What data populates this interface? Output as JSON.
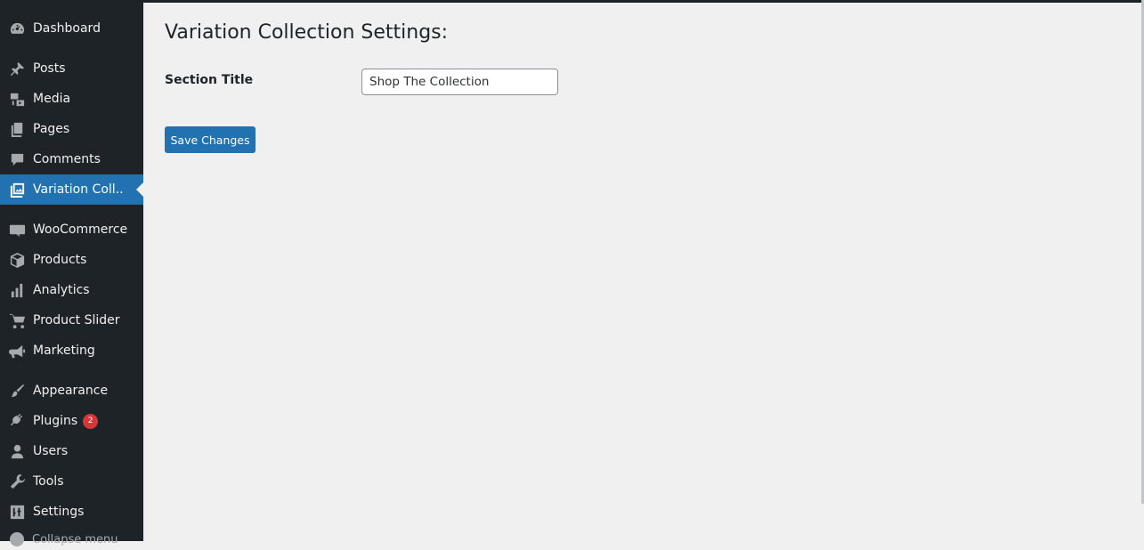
{
  "sidebar": {
    "items": [
      {
        "label": "Dashboard",
        "icon": "dashboard-icon"
      },
      {
        "label": "Posts",
        "icon": "pushpin-icon"
      },
      {
        "label": "Media",
        "icon": "media-icon"
      },
      {
        "label": "Pages",
        "icon": "pages-icon"
      },
      {
        "label": "Comments",
        "icon": "comment-icon"
      },
      {
        "label": "Variation Coll..",
        "icon": "gallery-icon",
        "current": true
      },
      {
        "label": "WooCommerce",
        "icon": "woo-icon"
      },
      {
        "label": "Products",
        "icon": "box-icon"
      },
      {
        "label": "Analytics",
        "icon": "bar-chart-icon"
      },
      {
        "label": "Product Slider",
        "icon": "cart-icon"
      },
      {
        "label": "Marketing",
        "icon": "megaphone-icon"
      },
      {
        "label": "Appearance",
        "icon": "brush-icon"
      },
      {
        "label": "Plugins",
        "icon": "plug-icon",
        "badge": "2"
      },
      {
        "label": "Users",
        "icon": "user-icon"
      },
      {
        "label": "Tools",
        "icon": "wrench-icon"
      },
      {
        "label": "Settings",
        "icon": "sliders-icon"
      }
    ],
    "collapse_label": "Collapse menu"
  },
  "main": {
    "title": "Variation Collection Settings:",
    "field_label": "Section Title",
    "field_value": "Shop The Collection",
    "save_label": "Save Changes"
  },
  "colors": {
    "sidebar_bg": "#1d2327",
    "accent": "#2271b1",
    "page_bg": "#f0f0f1",
    "badge": "#d63638"
  }
}
